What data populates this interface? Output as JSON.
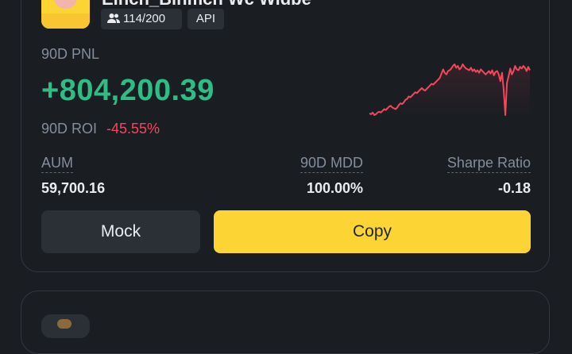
{
  "trader": {
    "name": "Einch_Binmch Wc Widbe",
    "followers": "114/200",
    "tag": "API",
    "avatar_icon": "avatar-icon",
    "followers_icon": "people-icon"
  },
  "pnl": {
    "label": "90D PNL",
    "value": "+804,200.39",
    "color": "#2ebd85"
  },
  "roi": {
    "label": "90D ROI",
    "value": "-45.55%",
    "color": "#f6465d"
  },
  "metrics": {
    "aum_label": "AUM",
    "aum_value": "59,700.16",
    "mdd_label": "90D MDD",
    "mdd_value": "100.00%",
    "sharpe_label": "Sharpe Ratio",
    "sharpe_value": "-0.18"
  },
  "sparkline": {
    "color": "#f6465d",
    "values": [
      32,
      31,
      33,
      30,
      31,
      33,
      34,
      33,
      35,
      37,
      36,
      38,
      40,
      41,
      39,
      38,
      37,
      39,
      42,
      44,
      43,
      45,
      48,
      49,
      52,
      51,
      53,
      55,
      57,
      56,
      58,
      60,
      62,
      60,
      59,
      61,
      63,
      65,
      67,
      66,
      68,
      70,
      72,
      74,
      79,
      84,
      80,
      78,
      82,
      83,
      85,
      88,
      90,
      86,
      88,
      84,
      86,
      90,
      87,
      85,
      84,
      83,
      86,
      82,
      84,
      81,
      83,
      80,
      84,
      82,
      80,
      78,
      80,
      82,
      79,
      83,
      77,
      81,
      82,
      78,
      70,
      80,
      60,
      30,
      68,
      76,
      85,
      78,
      82,
      88,
      84,
      83,
      87,
      85,
      88,
      86,
      82,
      87,
      83
    ]
  },
  "actions": {
    "mock_label": "Mock",
    "copy_label": "Copy",
    "copy_color": "#fcd535"
  }
}
